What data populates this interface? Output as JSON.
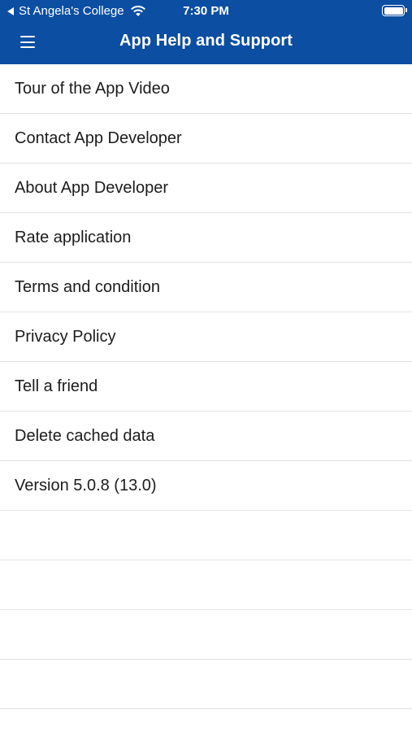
{
  "status_bar": {
    "back_app": "St Angela's College",
    "time": "7:30 PM",
    "icons": [
      "back-arrow-icon",
      "wifi-icon",
      "battery-icon"
    ]
  },
  "nav": {
    "title": "App Help and Support",
    "menu_icon": "hamburger-menu-icon"
  },
  "colors": {
    "header_bg": "#0b4ea2",
    "header_text": "#ffffff",
    "row_text": "#1c1c1e",
    "divider": "#e3e3e6"
  },
  "menu": {
    "items": [
      {
        "label": "Tour of the App Video"
      },
      {
        "label": "Contact App Developer"
      },
      {
        "label": "About App Developer"
      },
      {
        "label": "Rate application"
      },
      {
        "label": "Terms and condition"
      },
      {
        "label": "Privacy Policy"
      },
      {
        "label": "Tell a friend"
      },
      {
        "label": "Delete cached data"
      },
      {
        "label": "Version 5.0.8 (13.0)"
      }
    ]
  }
}
